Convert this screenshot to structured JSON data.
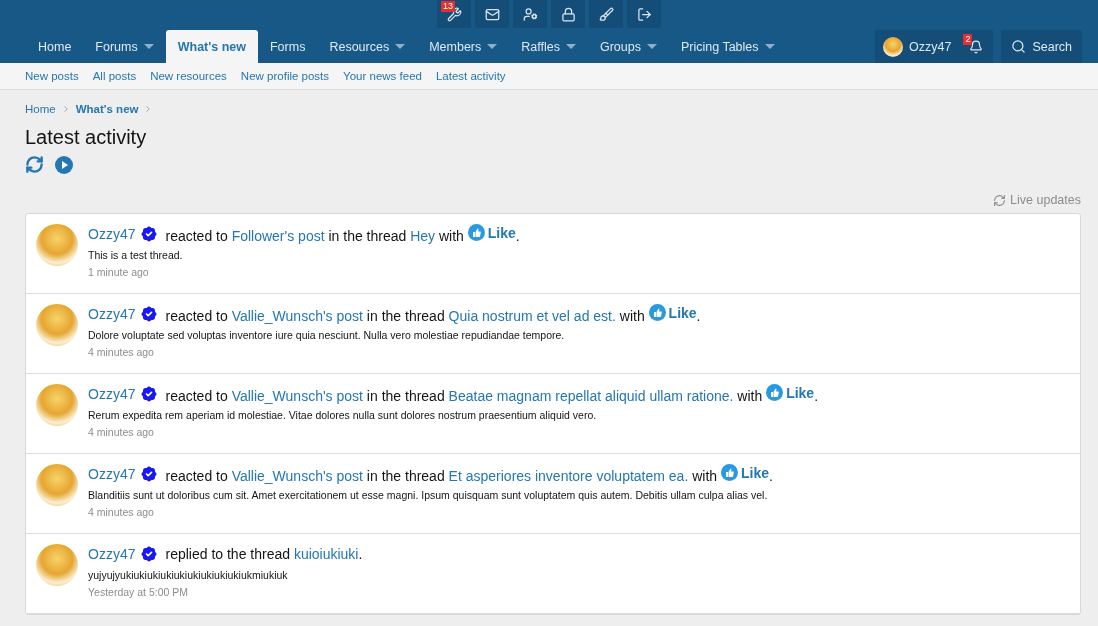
{
  "toolbar": {
    "items": [
      {
        "kind": "tools",
        "badge": "13"
      },
      {
        "kind": "mail"
      },
      {
        "kind": "users"
      },
      {
        "kind": "lock"
      },
      {
        "kind": "brush"
      },
      {
        "kind": "logout"
      }
    ]
  },
  "nav": {
    "tabs": [
      {
        "label": "Home",
        "selected": false,
        "dropdown": false
      },
      {
        "label": "Forums",
        "selected": false,
        "dropdown": true
      },
      {
        "label": "What's new",
        "selected": true,
        "dropdown": false
      },
      {
        "label": "Forms",
        "selected": false,
        "dropdown": false
      },
      {
        "label": "Resources",
        "selected": false,
        "dropdown": true
      },
      {
        "label": "Members",
        "selected": false,
        "dropdown": true
      },
      {
        "label": "Raffles",
        "selected": false,
        "dropdown": true
      },
      {
        "label": "Groups",
        "selected": false,
        "dropdown": true
      },
      {
        "label": "Pricing Tables",
        "selected": false,
        "dropdown": true
      }
    ],
    "user": "Ozzy47",
    "alerts_badge": "2",
    "search": "Search"
  },
  "subnav": [
    "New posts",
    "All posts",
    "New resources",
    "New profile posts",
    "Your news feed",
    "Latest activity"
  ],
  "breadcrumbs": [
    {
      "label": "Home",
      "current": false
    },
    {
      "label": "What's new",
      "current": true
    }
  ],
  "title": "Latest activity",
  "live_updates": "Live updates",
  "activity": [
    {
      "user": "Ozzy47",
      "parts": [
        {
          "kind": "text",
          "text": "reacted to "
        },
        {
          "kind": "link",
          "text": "Follower's post"
        },
        {
          "kind": "text",
          "text": " in the thread "
        },
        {
          "kind": "link",
          "text": "Hey"
        },
        {
          "kind": "text",
          "text": " with "
        },
        {
          "kind": "reaction",
          "text": "Like"
        },
        {
          "kind": "text",
          "text": "."
        }
      ],
      "snippet": "This is a test thread.",
      "time": "1 minute ago"
    },
    {
      "user": "Ozzy47",
      "parts": [
        {
          "kind": "text",
          "text": "reacted to "
        },
        {
          "kind": "link",
          "text": "Vallie_Wunsch's post"
        },
        {
          "kind": "text",
          "text": " in the thread "
        },
        {
          "kind": "link",
          "text": "Quia nostrum et vel ad est."
        },
        {
          "kind": "text",
          "text": " with "
        },
        {
          "kind": "reaction",
          "text": "Like"
        },
        {
          "kind": "text",
          "text": "."
        }
      ],
      "snippet": "Dolore voluptate sed voluptas inventore iure quia nesciunt. Nulla vero molestiae repudiandae tempore.",
      "time": "4 minutes ago"
    },
    {
      "user": "Ozzy47",
      "parts": [
        {
          "kind": "text",
          "text": "reacted to "
        },
        {
          "kind": "link",
          "text": "Vallie_Wunsch's post"
        },
        {
          "kind": "text",
          "text": " in the thread "
        },
        {
          "kind": "link",
          "text": "Beatae magnam repellat aliquid ullam ratione."
        },
        {
          "kind": "text",
          "text": " with "
        },
        {
          "kind": "reaction",
          "text": "Like"
        },
        {
          "kind": "text",
          "text": "."
        }
      ],
      "snippet": "Rerum expedita rem aperiam id molestiae. Vitae dolores nulla sunt dolores nostrum praesentium aliquid vero.",
      "time": "4 minutes ago"
    },
    {
      "user": "Ozzy47",
      "parts": [
        {
          "kind": "text",
          "text": "reacted to "
        },
        {
          "kind": "link",
          "text": "Vallie_Wunsch's post"
        },
        {
          "kind": "text",
          "text": " in the thread "
        },
        {
          "kind": "link",
          "text": "Et asperiores inventore voluptatem ea."
        },
        {
          "kind": "text",
          "text": " with "
        },
        {
          "kind": "reaction",
          "text": "Like"
        },
        {
          "kind": "text",
          "text": "."
        }
      ],
      "snippet": "Blanditiis sunt ut doloribus cum sit. Amet exercitationem ut esse magni. Ipsum quisquam sunt voluptatem quis autem. Debitis ullam culpa alias vel.",
      "time": "4 minutes ago"
    },
    {
      "user": "Ozzy47",
      "parts": [
        {
          "kind": "text",
          "text": "replied to the thread "
        },
        {
          "kind": "link",
          "text": "kuioiukiuki"
        },
        {
          "kind": "text",
          "text": "."
        }
      ],
      "snippet": "yujyujyukiukiukiukiukiukiukiukiukiukmiukiuk",
      "time": "Yesterday at 5:00 PM"
    }
  ]
}
